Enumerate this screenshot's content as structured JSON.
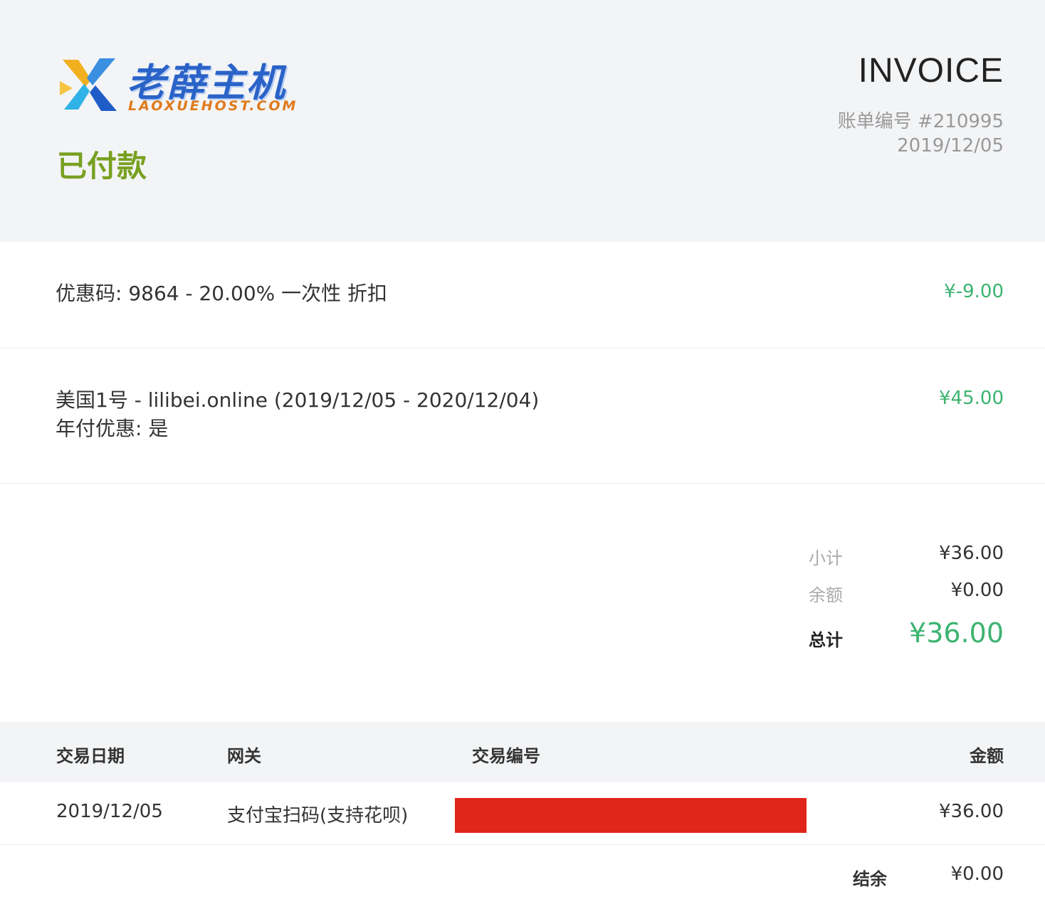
{
  "header": {
    "logo": {
      "cn_text": "老薛主机",
      "en_text": "LAOXUEHOST.COM"
    },
    "status": "已付款",
    "title": "INVOICE",
    "invoice_number": "账单编号 #210995",
    "invoice_date": "2019/12/05"
  },
  "items": [
    {
      "description": "优惠码: 9864 - 20.00% 一次性 折扣",
      "amount": "¥-9.00"
    },
    {
      "description": "美国1号 - lilibei.online (2019/12/05 - 2020/12/04)",
      "description_line2": "年付优惠: 是",
      "amount": "¥45.00"
    }
  ],
  "totals": {
    "subtotal_label": "小计",
    "subtotal_value": "¥36.00",
    "credit_label": "余额",
    "credit_value": "¥0.00",
    "total_label": "总计",
    "total_value": "¥36.00"
  },
  "transactions": {
    "headers": {
      "date": "交易日期",
      "gateway": "网关",
      "txid": "交易编号",
      "amount": "金额"
    },
    "rows": [
      {
        "date": "2019/12/05",
        "gateway": "支付宝扫码(支持花呗)",
        "amount": "¥36.00"
      }
    ],
    "balance_label": "结余",
    "balance_value": "¥0.00"
  },
  "colors": {
    "status": "#78a020",
    "amount_green": "#3cb371",
    "redaction": "#e0261a",
    "header_bg": "#f3f4f6"
  }
}
